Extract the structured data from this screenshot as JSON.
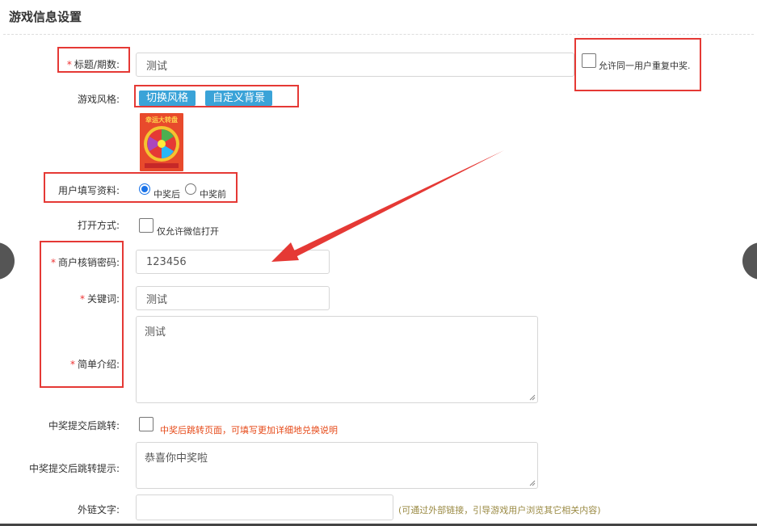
{
  "section_title": "游戏信息设置",
  "fields": {
    "title": {
      "label": "标题/期数:",
      "value": "测试"
    },
    "allow_repeat": {
      "label": "允许同一用户重复中奖."
    },
    "style": {
      "label": "游戏风格:",
      "switch_btn": "切换风格",
      "custom_bg_btn": "自定义背景"
    },
    "thumb_text": "幸运大转盘",
    "user_info": {
      "label": "用户填写资料:",
      "opt1": "中奖后",
      "opt2": "中奖前"
    },
    "open_mode": {
      "label": "打开方式:",
      "option": "仅允许微信打开"
    },
    "merchant_pwd": {
      "label": "商户核销密码:",
      "value": "123456"
    },
    "keyword": {
      "label": "关键词:",
      "value": "测试"
    },
    "intro": {
      "label": "简单介绍:",
      "value": "测试"
    },
    "redirect": {
      "label": "中奖提交后跳转:",
      "note": "中奖后跳转页面，可填写更加详细地兑换说明"
    },
    "redirect_tip": {
      "label": "中奖提交后跳转提示:",
      "value": "恭喜你中奖啦"
    },
    "external_text": {
      "label": "外链文字:",
      "note": "(可通过外部链接，引导游戏用户浏览其它相关内容)"
    }
  },
  "colors": {
    "accent": "#3aa3d8",
    "highlight": "#e53935",
    "required": "#e33",
    "note": "#e64a19"
  }
}
